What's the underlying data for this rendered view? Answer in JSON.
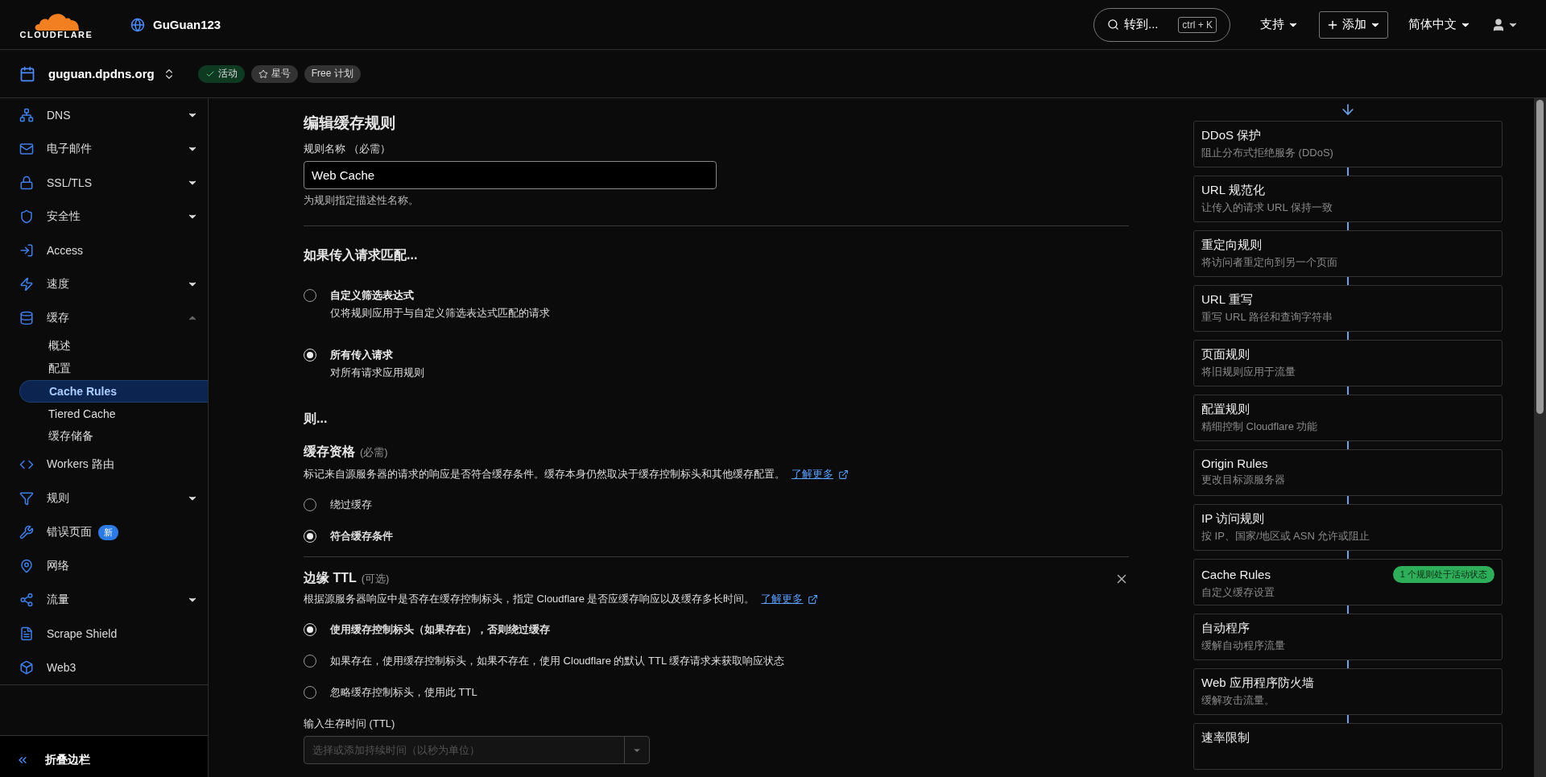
{
  "header": {
    "logo_text": "CLOUDFLARE",
    "account": "GuGuan123",
    "search": {
      "label": "转到...",
      "shortcut": "ctrl + K"
    },
    "menus": [
      {
        "label": "支持",
        "kind": "dropdown"
      },
      {
        "label": "添加",
        "kind": "add"
      },
      {
        "label": "简体中文",
        "kind": "dropdown"
      }
    ]
  },
  "zone_bar": {
    "domain": "guguan.dpdns.org",
    "badges": [
      {
        "label": "活动",
        "kind": "status"
      },
      {
        "label": "星号",
        "kind": "star"
      },
      {
        "label": "Free 计划",
        "kind": "plan"
      }
    ]
  },
  "sidebar": {
    "items": [
      {
        "label": "DNS",
        "kind": "group",
        "expanded": false
      },
      {
        "label": "电子邮件",
        "kind": "group",
        "expanded": false
      },
      {
        "label": "SSL/TLS",
        "kind": "group",
        "expanded": false
      },
      {
        "label": "安全性",
        "kind": "group",
        "expanded": false
      },
      {
        "label": "Access",
        "kind": "link"
      },
      {
        "label": "速度",
        "kind": "group",
        "expanded": false
      },
      {
        "label": "缓存",
        "kind": "group",
        "expanded": true,
        "children": [
          {
            "label": "概述",
            "selected": false
          },
          {
            "label": "配置",
            "selected": false
          },
          {
            "label": "Cache Rules",
            "selected": true
          },
          {
            "label": "Tiered Cache",
            "selected": false
          },
          {
            "label": "缓存储备",
            "selected": false
          }
        ]
      },
      {
        "label": "Workers 路由",
        "kind": "link"
      },
      {
        "label": "规则",
        "kind": "group",
        "expanded": false
      },
      {
        "label": "错误页面",
        "kind": "link",
        "badge": "新"
      },
      {
        "label": "网络",
        "kind": "link"
      },
      {
        "label": "流量",
        "kind": "group",
        "expanded": false
      },
      {
        "label": "Scrape Shield",
        "kind": "link"
      },
      {
        "label": "Web3",
        "kind": "link"
      }
    ],
    "collapse": "折叠边栏"
  },
  "main": {
    "title": "编辑缓存规则",
    "name_field": {
      "label": "规则名称 （必需）",
      "value": "Web Cache",
      "help": "为规则指定描述性名称。"
    },
    "match": {
      "heading": "如果传入请求匹配...",
      "options": [
        {
          "title": "自定义筛选表达式",
          "description": "仅将规则应用于与自定义筛选表达式匹配的请求",
          "selected": false
        },
        {
          "title": "所有传入请求",
          "description": "对所有请求应用规则",
          "selected": true
        }
      ]
    },
    "then_heading": "则...",
    "cache_eligibility": {
      "title": "缓存资格",
      "note": "(必需)",
      "description": "标记来自源服务器的请求的响应是否符合缓存条件。缓存本身仍然取决于缓存控制标头和其他缓存配置。",
      "link": "了解更多",
      "options": [
        {
          "label": "绕过缓存",
          "selected": false
        },
        {
          "label": "符合缓存条件",
          "selected": true
        }
      ]
    },
    "edge_ttl": {
      "title": "边缘 TTL",
      "note": "(可选)",
      "description": "根据源服务器响应中是否存在缓存控制标头，指定 Cloudflare 是否应缓存响应以及缓存多长时间。",
      "link": "了解更多",
      "options": [
        {
          "label": "使用缓存控制标头（如果存在），否则绕过缓存",
          "selected": true
        },
        {
          "label": "如果存在，使用缓存控制标头，如果不存在，使用 Cloudflare 的默认 TTL 缓存请求来获取响应状态",
          "selected": false
        },
        {
          "label": "忽略缓存控制标头，使用此 TTL",
          "selected": false
        }
      ],
      "ttl_field": {
        "label": "输入生存时间 (TTL)",
        "placeholder": "选择或添加持续时间（以秒为单位）",
        "disabled": true
      }
    }
  },
  "pipeline": {
    "cards": [
      {
        "title": "DDoS 保护",
        "description": "阻止分布式拒绝服务 (DDoS)"
      },
      {
        "title": "URL 规范化",
        "description": "让传入的请求 URL 保持一致"
      },
      {
        "title": "重定向规则",
        "description": "将访问者重定向到另一个页面"
      },
      {
        "title": "URL 重写",
        "description": "重写 URL 路径和查询字符串"
      },
      {
        "title": "页面规则",
        "description": "将旧规则应用于流量"
      },
      {
        "title": "配置规则",
        "description": "精细控制 Cloudflare 功能"
      },
      {
        "title": "Origin Rules",
        "description": "更改目标源服务器"
      },
      {
        "title": "IP 访问规则",
        "description": "按 IP、国家/地区或 ASN 允许或阻止"
      },
      {
        "title": "Cache Rules",
        "description": "自定义缓存设置",
        "badge": "1 个规则处于活动状态"
      },
      {
        "title": "自动程序",
        "description": "缓解自动程序流量"
      },
      {
        "title": "Web 应用程序防火墙",
        "description": "缓解攻击流量。"
      },
      {
        "title": "速率限制"
      }
    ]
  }
}
